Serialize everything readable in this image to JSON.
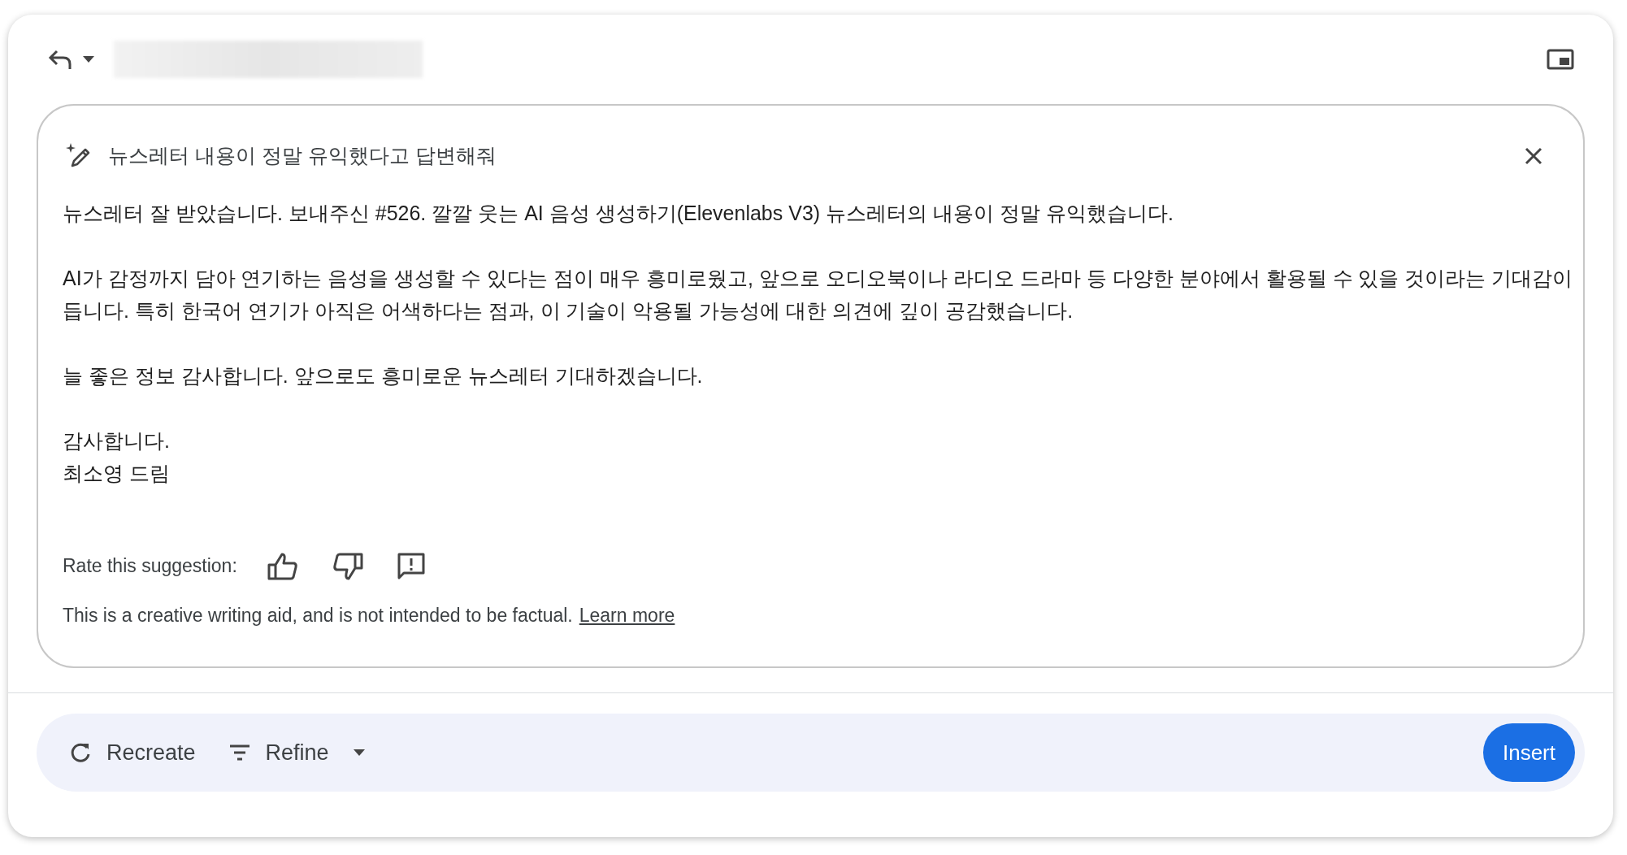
{
  "prompt": {
    "text": "뉴스레터 내용이 정말 유익했다고 답변해줘"
  },
  "body": [
    "뉴스레터 잘 받았습니다. 보내주신 #526. 깔깔 웃는 AI 음성 생성하기(Elevenlabs V3) 뉴스레터의 내용이 정말 유익했습니다.",
    "AI가 감정까지 담아 연기하는 음성을 생성할 수 있다는 점이 매우 흥미로웠고, 앞으로 오디오북이나 라디오 드라마 등 다양한 분야에서 활용될 수 있을 것이라는 기대감이 듭니다. 특히 한국어 연기가 아직은 어색하다는 점과, 이 기술이 악용될 가능성에 대한 의견에 깊이 공감했습니다.",
    "늘 좋은 정보 감사합니다. 앞으로도 흥미로운 뉴스레터 기대하겠습니다.",
    "감사합니다.\n최소영 드림"
  ],
  "rating": {
    "label": "Rate this suggestion:"
  },
  "disclaimer": {
    "text": "This is a creative writing aid, and is not intended to be factual.",
    "link": "Learn more"
  },
  "actions": [
    {
      "label": "Recreate",
      "kind": "recreate"
    },
    {
      "label": "Refine",
      "kind": "refine"
    }
  ],
  "insert_button": "Insert"
}
